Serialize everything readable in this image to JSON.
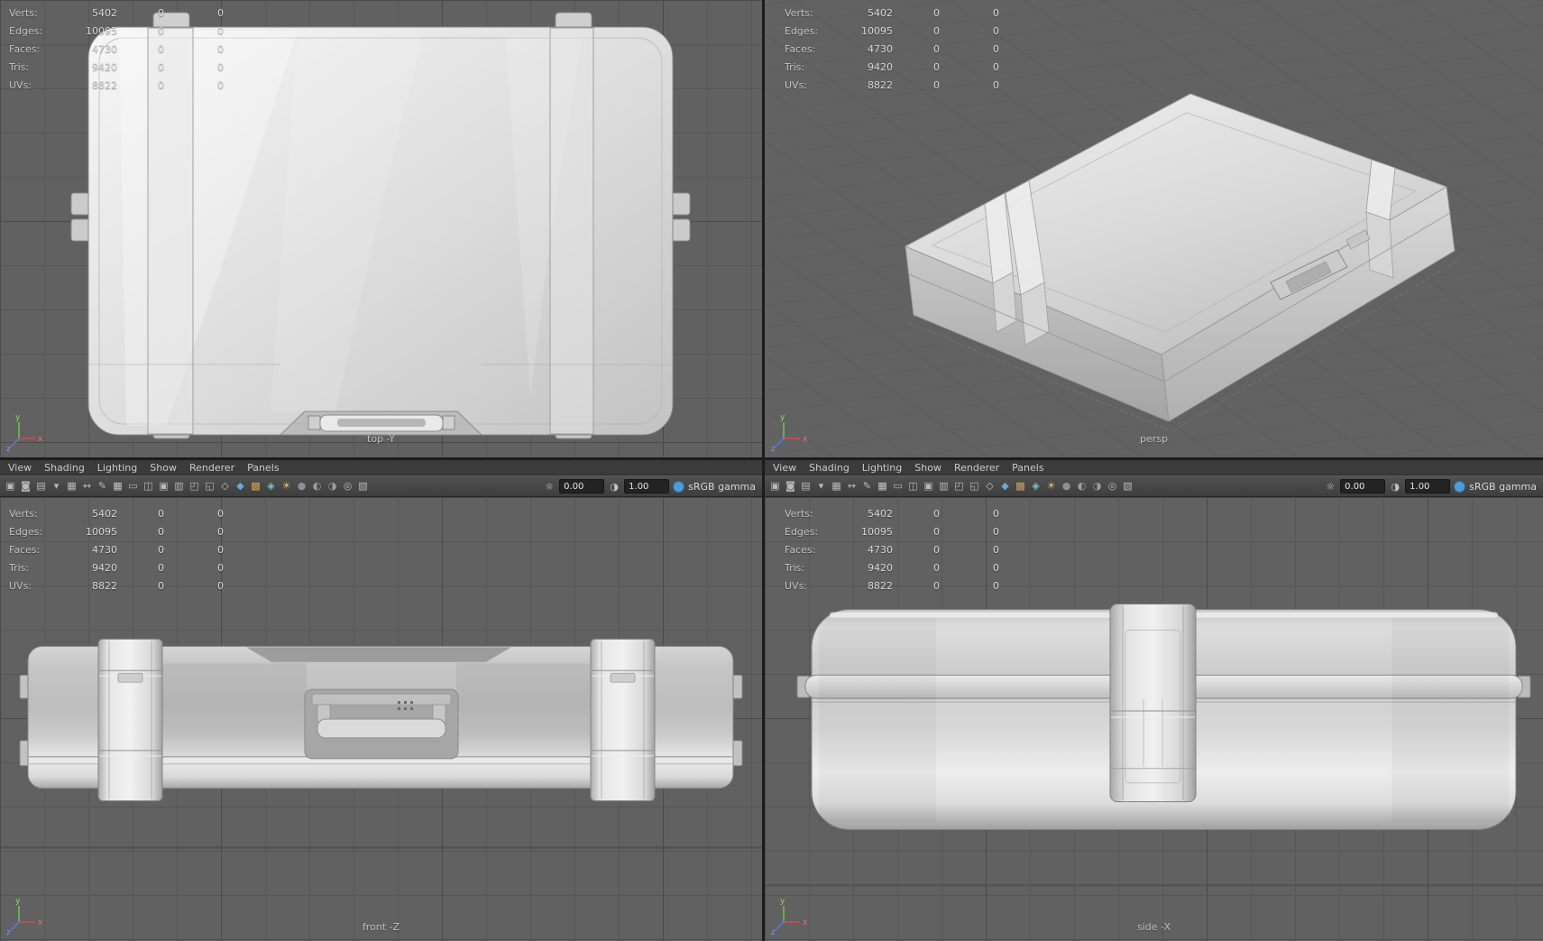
{
  "hud": {
    "rows": [
      {
        "label": "Verts:",
        "value": "5402",
        "z1": "0",
        "z2": "0"
      },
      {
        "label": "Edges:",
        "value": "10095",
        "z1": "0",
        "z2": "0"
      },
      {
        "label": "Faces:",
        "value": "4730",
        "z1": "0",
        "z2": "0"
      },
      {
        "label": "Tris:",
        "value": "9420",
        "z1": "0",
        "z2": "0"
      },
      {
        "label": "UVs:",
        "value": "8822",
        "z1": "0",
        "z2": "0"
      }
    ]
  },
  "viewports": {
    "top": {
      "label": "top -Y"
    },
    "persp": {
      "label": "persp"
    },
    "front": {
      "label": "front -Z"
    },
    "side": {
      "label": "side -X"
    }
  },
  "panel_menu": {
    "items": [
      "View",
      "Shading",
      "Lighting",
      "Show",
      "Renderer",
      "Panels"
    ]
  },
  "toolbar": {
    "icons": [
      {
        "name": "camera-select-icon",
        "glyph": "▣",
        "color": "#b9b9b9"
      },
      {
        "name": "camera-lock-icon",
        "glyph": "◙",
        "color": "#b9b9b9"
      },
      {
        "name": "camera-attributes-icon",
        "glyph": "▤",
        "color": "#b9b9b9"
      },
      {
        "name": "bookmark-icon",
        "glyph": "▾",
        "color": "#b9b9b9"
      },
      {
        "name": "image-plane-icon",
        "glyph": "▦",
        "color": "#b9b9b9"
      },
      {
        "name": "pan-zoom-icon",
        "glyph": "↔",
        "color": "#b9b9b9"
      },
      {
        "name": "grease-pencil-icon",
        "glyph": "✎",
        "color": "#b9b9b9"
      },
      {
        "name": "grid-icon",
        "glyph": "▦",
        "color": "#c6c6c6"
      },
      {
        "name": "film-gate-icon",
        "glyph": "▭",
        "color": "#b9b9b9"
      },
      {
        "name": "resolution-gate-icon",
        "glyph": "◫",
        "color": "#b9b9b9"
      },
      {
        "name": "gate-mask-icon",
        "glyph": "▣",
        "color": "#b9b9b9"
      },
      {
        "name": "field-chart-icon",
        "glyph": "▥",
        "color": "#b9b9b9"
      },
      {
        "name": "safe-action-icon",
        "glyph": "◰",
        "color": "#b9b9b9"
      },
      {
        "name": "safe-title-icon",
        "glyph": "◱",
        "color": "#b9b9b9"
      },
      {
        "name": "wireframe-icon",
        "glyph": "◇",
        "color": "#c0c0c0"
      },
      {
        "name": "smooth-shade-icon",
        "glyph": "◆",
        "color": "#69a8dd"
      },
      {
        "name": "textured-icon",
        "glyph": "▩",
        "color": "#c9a55a"
      },
      {
        "name": "wire-on-shaded-icon",
        "glyph": "◈",
        "color": "#6fc7c7"
      },
      {
        "name": "lights-icon",
        "glyph": "☀",
        "color": "#e2c45a"
      },
      {
        "name": "shadows-icon",
        "glyph": "●",
        "color": "#8f8f8f"
      },
      {
        "name": "occlusion-icon",
        "glyph": "◐",
        "color": "#9d9d9d"
      },
      {
        "name": "motion-blur-icon",
        "glyph": "◑",
        "color": "#9d9d9d"
      },
      {
        "name": "isolate-select-icon",
        "glyph": "◎",
        "color": "#b9b9b9"
      },
      {
        "name": "xray-icon",
        "glyph": "▧",
        "color": "#b9b9b9"
      }
    ],
    "exposure_icon": "☼",
    "exposure_value": "0.00",
    "contrast_icon": "◑",
    "gamma_value": "1.00",
    "colorspace_label": "sRGB gamma",
    "colorspace_icon_color": "#4f9bd5"
  },
  "axis_gizmo": {
    "x_label": "x",
    "y_label": "y",
    "z_label": "z",
    "x_color": "#d84a4a",
    "y_color": "#6fbf4f",
    "z_color": "#5577dd"
  },
  "colors": {
    "viewport_bg": "#616161",
    "grid_line": "#565656",
    "menu_bg": "#3b3b3b",
    "model_light": "#ececec",
    "model_dark": "#a8a8a8"
  }
}
